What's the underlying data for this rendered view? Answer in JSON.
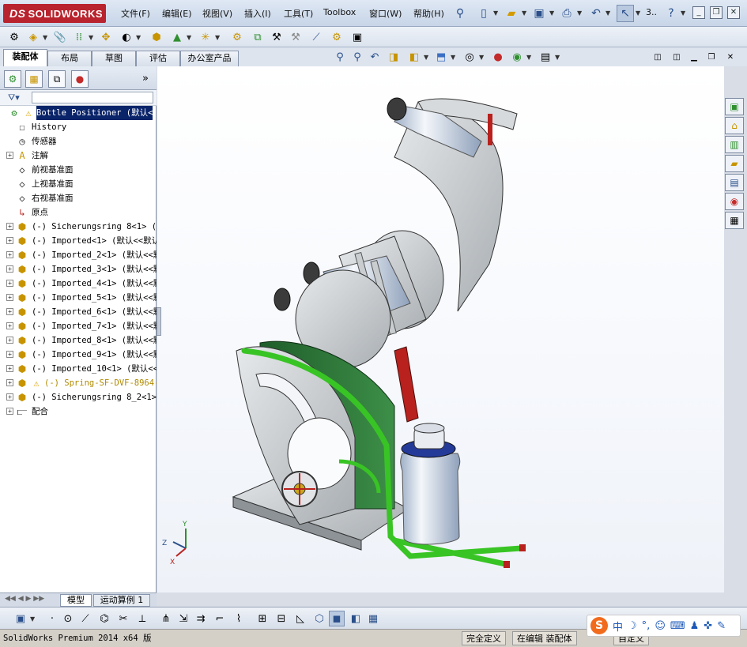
{
  "app": {
    "logo": "SOLIDWORKS",
    "logo_prefix": "DS"
  },
  "menu": [
    "文件(F)",
    "编辑(E)",
    "视图(V)",
    "插入(I)",
    "工具(T)",
    "Toolbox",
    "窗口(W)",
    "帮助(H)"
  ],
  "quick": {
    "overflow_label": "3.."
  },
  "tabs": [
    "装配体",
    "布局",
    "草图",
    "评估",
    "办公室产品"
  ],
  "fm": {
    "expand_label": "»",
    "root": "Bottle Positioner  (默认<",
    "items": [
      "History",
      "传感器",
      "注解",
      "前视基准面",
      "上视基准面",
      "右视基准面",
      "原点",
      "(-) Sicherungsring 8<1> (默",
      "(-) Imported<1> (默认<<默认",
      "(-) Imported_2<1> (默认<<默",
      "(-) Imported_3<1> (默认<<默",
      "(-) Imported_4<1> (默认<<默",
      "(-) Imported_5<1> (默认<<默",
      "(-) Imported_6<1> (默认<<默",
      "(-) Imported_7<1> (默认<<默",
      "(-) Imported_8<1> (默认<<默",
      "(-) Imported_9<1> (默认<<默",
      "(-) Imported_10<1> (默认<<",
      "(-) Spring-SF-DVF-8964-",
      "(-) Sicherungsring 8_2<1> (",
      "配合"
    ]
  },
  "bottom_tabs": [
    "模型",
    "运动算例 1"
  ],
  "triad": {
    "x": "X",
    "y": "Y",
    "z": "Z"
  },
  "status": {
    "app": "SolidWorks Premium 2014 x64 版",
    "defined": "完全定义",
    "editing": "在编辑 装配体",
    "custom": "自定义"
  },
  "ime": {
    "logo": "S",
    "mode": "中"
  },
  "colors": {
    "accent": "#b8232d",
    "selection": "#0a246a",
    "part_gray": "#cfd3d6",
    "part_green": "#2f7a3b",
    "tube_green": "#39c425",
    "frame_red": "#b8211d",
    "bottle": "#dbe3ee"
  }
}
